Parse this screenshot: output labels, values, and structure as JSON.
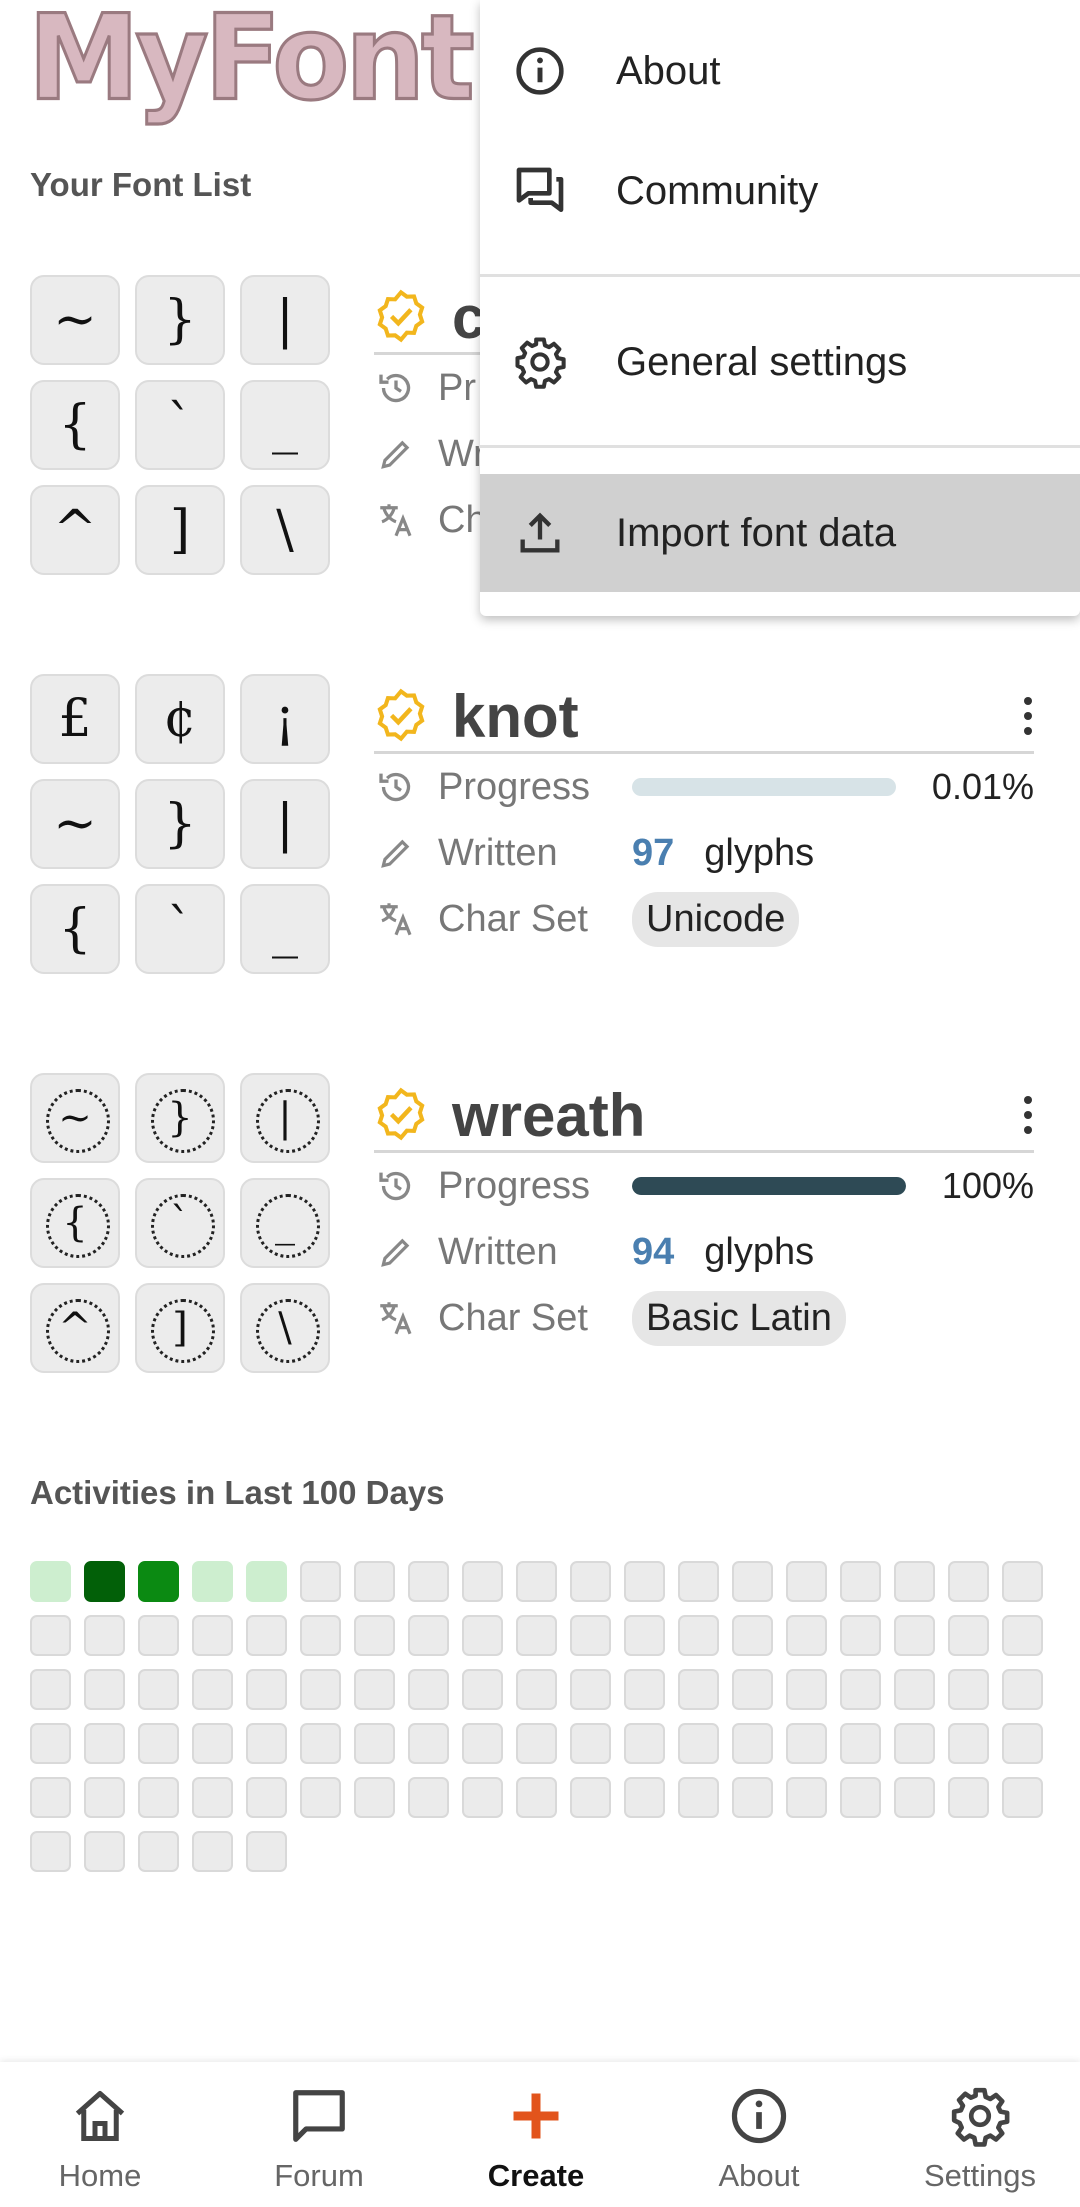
{
  "app": {
    "logo_text": "MyFont"
  },
  "sections": {
    "font_list_title": "Your Font List",
    "activities_title": "Activities in Last 100 Days"
  },
  "fonts": [
    {
      "name": "c",
      "glyphs": [
        "~",
        "}",
        "|",
        "{",
        "`",
        "_",
        "^",
        "]",
        "\\"
      ],
      "progress_label": "Pr",
      "written_label": "Wr",
      "charset_label": "Ch"
    },
    {
      "name": "knot",
      "glyphs": [
        "£",
        "¢",
        "¡",
        "~",
        "}",
        "|",
        "{",
        "`",
        "_"
      ],
      "progress_label": "Progress",
      "progress_value": 0.0001,
      "progress_text": "0.01%",
      "written_label": "Written",
      "written_count": "97",
      "written_unit": "glyphs",
      "charset_label": "Char Set",
      "charset": "Unicode"
    },
    {
      "name": "wreath",
      "glyphs": [
        "~",
        "}",
        "|",
        "{",
        "`",
        "_",
        "^",
        "]",
        "\\"
      ],
      "progress_label": "Progress",
      "progress_value": 1.0,
      "progress_text": "100%",
      "written_label": "Written",
      "written_count": "94",
      "written_unit": "glyphs",
      "charset_label": "Char Set",
      "charset": "Basic Latin"
    }
  ],
  "activity": {
    "total_days": 100,
    "levels": [
      1,
      3,
      2,
      1,
      1
    ],
    "colors": {
      "empty": "#ebebeb",
      "l1": "#cdeecf",
      "l2": "#0b8a12",
      "l3": "#026008"
    }
  },
  "menu": {
    "items": [
      {
        "label": "About",
        "icon": "info-icon"
      },
      {
        "label": "Community",
        "icon": "forum-icon"
      },
      {
        "label": "General settings",
        "icon": "gear-icon"
      },
      {
        "label": "Import font data",
        "icon": "upload-icon"
      }
    ]
  },
  "nav": {
    "items": [
      {
        "label": "Home",
        "icon": "home-icon"
      },
      {
        "label": "Forum",
        "icon": "forum-icon"
      },
      {
        "label": "Create",
        "icon": "plus-icon"
      },
      {
        "label": "About",
        "icon": "info-icon"
      },
      {
        "label": "Settings",
        "icon": "gear-icon"
      }
    ],
    "active": "Create",
    "accent_color": "#e2541c"
  },
  "colors": {
    "badge": "#f2b61d",
    "count": "#4a7fb0",
    "progress_fill": "#2e4a55",
    "progress_track": "#d7e3e7"
  }
}
